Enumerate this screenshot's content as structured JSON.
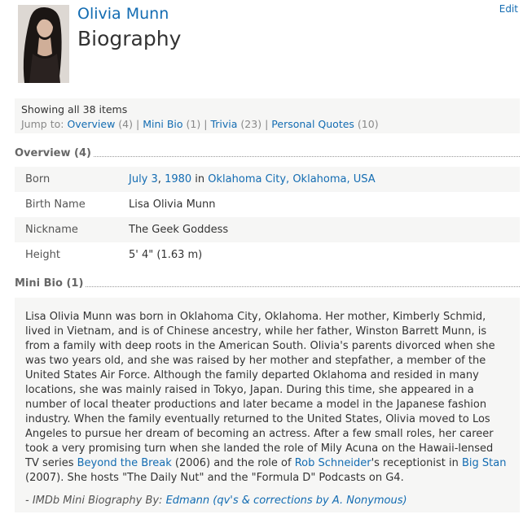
{
  "header": {
    "name": "Olivia Munn",
    "title": "Biography",
    "edit_label": "Edit",
    "photo_alt": "Olivia Munn photo"
  },
  "jump": {
    "showing": "Showing all 38 items",
    "prefix": "Jump to: ",
    "links": [
      {
        "label": "Overview",
        "count": "(4)"
      },
      {
        "label": "Mini Bio",
        "count": "(1)"
      },
      {
        "label": "Trivia",
        "count": "(23)"
      },
      {
        "label": "Personal Quotes",
        "count": "(10)"
      }
    ]
  },
  "overview": {
    "heading": "Overview (4)",
    "born": {
      "label": "Born",
      "date": "July 3",
      "comma": ", ",
      "year": "1980",
      "in": " in ",
      "place": "Oklahoma City, Oklahoma, USA"
    },
    "rows": [
      {
        "label": "Birth Name",
        "value": "Lisa Olivia Munn"
      },
      {
        "label": "Nickname",
        "value": "The Geek Goddess"
      },
      {
        "label": "Height",
        "value": "5' 4\" (1.63 m)"
      }
    ]
  },
  "minibio": {
    "heading": "Mini Bio (1)",
    "text_1": "Lisa Olivia Munn was born in Oklahoma City, Oklahoma. Her mother, Kimberly Schmid, lived in Vietnam, and is of Chinese ancestry, while her father, Winston Barrett Munn, is from a family with deep roots in the American South. Olivia's parents divorced when she was two years old, and she was raised by her mother and stepfather, a member of the United States Air Force. Although the family departed Oklahoma and resided in many locations, she was mainly raised in Tokyo, Japan. During this time, she appeared in a number of local theater productions and later became a model in the Japanese fashion industry. When the family eventually returned to the United States, Olivia moved to Los Angeles to pursue her dream of becoming an actress. After a few small roles, her career took a very promising turn when she landed the role of Mily Acuna on the Hawaii-lensed TV series ",
    "link_1": "Beyond the Break",
    "text_2": " (2006) and the role of ",
    "link_2": "Rob Schneider",
    "text_3": "'s receptionist in ",
    "link_3": "Big Stan",
    "text_4": " (2007). She hosts \"The Daily Nut\" and the \"Formula D\" Podcasts on G4.",
    "byline_prefix": "- IMDb Mini Biography By: ",
    "byline_link": "Edmann (qv's & corrections by A. Nonymous)"
  }
}
